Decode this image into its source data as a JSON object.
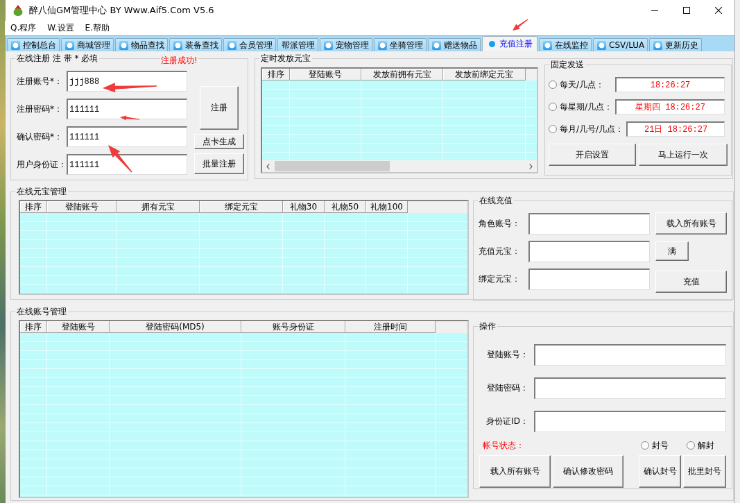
{
  "window": {
    "title": "醉八仙GM管理中心 BY Www.Aif5.Com V5.6"
  },
  "menu": [
    {
      "label": "Q.程序"
    },
    {
      "label": "W.设置"
    },
    {
      "label": "E.帮助"
    }
  ],
  "tabs": [
    {
      "label": "控制总台",
      "icon": true,
      "selected": false
    },
    {
      "label": "商城管理",
      "icon": true,
      "selected": false
    },
    {
      "label": "物品查找",
      "icon": true,
      "selected": false
    },
    {
      "label": "装备查找",
      "icon": true,
      "selected": false
    },
    {
      "label": "会员管理",
      "icon": true,
      "selected": false
    },
    {
      "label": "帮派管理",
      "icon": false,
      "selected": false
    },
    {
      "label": "宠物管理",
      "icon": true,
      "selected": false
    },
    {
      "label": "坐骑管理",
      "icon": true,
      "selected": false
    },
    {
      "label": "赠送物品",
      "icon": true,
      "selected": false
    },
    {
      "label": "充值注册",
      "icon": true,
      "selected": true
    },
    {
      "label": "在线监控",
      "icon": true,
      "selected": false
    },
    {
      "label": "CSV/LUA",
      "icon": true,
      "selected": false
    },
    {
      "label": "更新历史",
      "icon": true,
      "selected": false
    }
  ],
  "online_register": {
    "title": "在线注册 注 带 * 必填",
    "status": "注册成功!",
    "fields": [
      {
        "label": "注册账号*：",
        "value": "jjj888"
      },
      {
        "label": "注册密码*：",
        "value": "111111"
      },
      {
        "label": "确认密码*：",
        "value": "111111"
      },
      {
        "label": "用户身份证：",
        "value": "111111"
      }
    ],
    "buttons": [
      {
        "label": "注册"
      },
      {
        "label": "点卡生成"
      },
      {
        "label": "批量注册"
      }
    ]
  },
  "timed_ingot_grant": {
    "title": "定时发放元宝",
    "table": {
      "columns": [
        "排序",
        "登陆账号",
        "发放前拥有元宝",
        "发放前绑定元宝"
      ]
    },
    "fixed_send": {
      "title": "固定发送",
      "options": [
        {
          "label": "每天/几点：",
          "selected": false,
          "value": "18:26:27"
        },
        {
          "label": "每星期/几点：",
          "selected": false,
          "value": "星期四 18:26:27"
        },
        {
          "label": "每月/几号/几点：",
          "selected": false,
          "value": "21日 18:26:27"
        }
      ],
      "buttons": [
        {
          "label": "开启设置"
        },
        {
          "label": "马上运行一次"
        }
      ]
    }
  },
  "online_ingot_management": {
    "title": "在线元宝管理",
    "table": {
      "columns": [
        "排序",
        "登陆账号",
        "拥有元宝",
        "绑定元宝",
        "礼物30",
        "礼物50",
        "礼物100"
      ]
    },
    "online_recharge": {
      "title": "在线充值",
      "fields": [
        {
          "label": "角色账号：",
          "button": "载入所有账号"
        },
        {
          "label": "充值元宝：",
          "button": "满"
        },
        {
          "label": "绑定元宝：",
          "button": "充值"
        }
      ]
    }
  },
  "online_account_management": {
    "title": "在线账号管理",
    "table": {
      "columns": [
        "排序",
        "登陆账号",
        "登陆密码(MD5)",
        "账号身份证",
        "注册时间"
      ]
    },
    "operations": {
      "title": "操作",
      "fields": [
        {
          "label": "登陆账号："
        },
        {
          "label": "登陆密码："
        },
        {
          "label": "身份证ID："
        }
      ],
      "status_label": "帐号状态：",
      "status_options": [
        {
          "label": "封号",
          "selected": false
        },
        {
          "label": "解封",
          "selected": false
        }
      ],
      "buttons": [
        {
          "label": "载入所有账号"
        },
        {
          "label": "确认修改密码"
        },
        {
          "label": "确认封号"
        },
        {
          "label": "批里封号"
        }
      ]
    }
  }
}
